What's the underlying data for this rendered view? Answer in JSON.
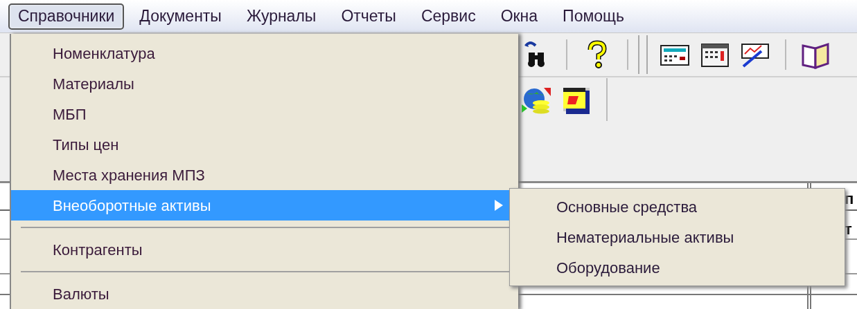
{
  "menubar": [
    {
      "label": "Справочники",
      "selected": true
    },
    {
      "label": "Документы",
      "selected": false
    },
    {
      "label": "Журналы",
      "selected": false
    },
    {
      "label": "Отчеты",
      "selected": false
    },
    {
      "label": "Сервис",
      "selected": false
    },
    {
      "label": "Окна",
      "selected": false
    },
    {
      "label": "Помощь",
      "selected": false
    }
  ],
  "menu": {
    "items": [
      {
        "kind": "item",
        "label": "Номенклатура",
        "selected": false,
        "submenu": false
      },
      {
        "kind": "item",
        "label": "Материалы",
        "selected": false,
        "submenu": false
      },
      {
        "kind": "item",
        "label": "МБП",
        "selected": false,
        "submenu": false
      },
      {
        "kind": "item",
        "label": "Типы цен",
        "selected": false,
        "submenu": false
      },
      {
        "kind": "item",
        "label": "Места хранения МПЗ",
        "selected": false,
        "submenu": false
      },
      {
        "kind": "item",
        "label": "Внеоборотные активы",
        "selected": true,
        "submenu": true
      },
      {
        "kind": "separator"
      },
      {
        "kind": "item",
        "label": "Контрагенты",
        "selected": false,
        "submenu": false
      },
      {
        "kind": "separator"
      },
      {
        "kind": "item",
        "label": "Валюты",
        "selected": false,
        "submenu": false
      }
    ]
  },
  "submenu": {
    "items": [
      {
        "label": "Основные средства"
      },
      {
        "label": "Нематериальные активы"
      },
      {
        "label": "Оборудование"
      }
    ]
  },
  "table": {
    "cells": [
      "п",
      "т"
    ]
  }
}
